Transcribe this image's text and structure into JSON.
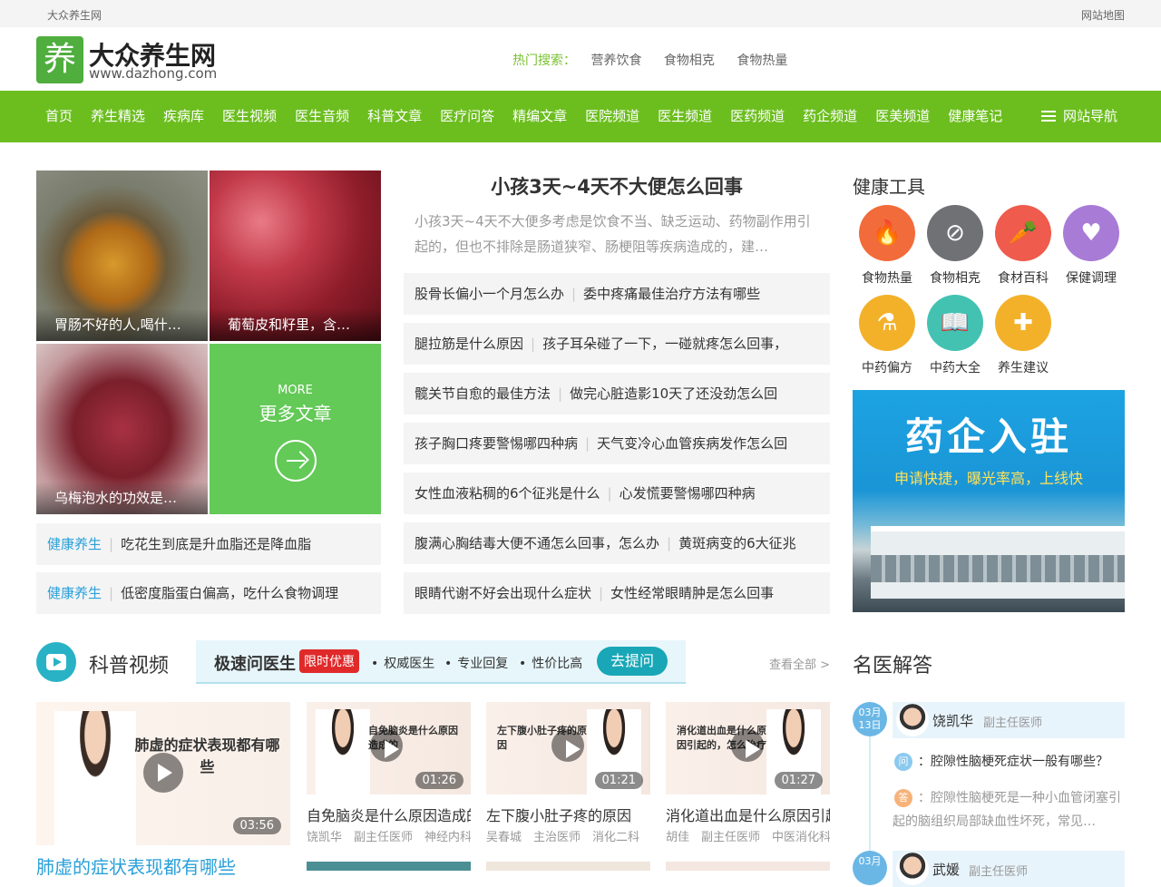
{
  "topbar": {
    "site": "大众养生网",
    "sitemap": "网站地图"
  },
  "header": {
    "logo_char": "养",
    "logo_name": "大众养生网",
    "logo_url": "www.dazhong.com",
    "hot_label": "热门搜索：",
    "hot_keywords": [
      "营养饮食",
      "食物相克",
      "食物热量"
    ]
  },
  "nav": {
    "items": [
      "首页",
      "养生精选",
      "疾病库",
      "医生视频",
      "医生音频",
      "科普文章",
      "医疗问答",
      "精编文章",
      "医院频道",
      "医生频道",
      "医药频道",
      "药企频道",
      "医美频道",
      "健康笔记"
    ],
    "site_nav": "网站导航"
  },
  "featured_tiles": [
    {
      "caption": "胃肠不好的人,喝什…"
    },
    {
      "caption": "葡萄皮和籽里，含…"
    },
    {
      "caption": "乌梅泡水的功效是…"
    }
  ],
  "more": {
    "en": "MORE",
    "cn": "更多文章"
  },
  "left_list": [
    {
      "tag": "健康养生",
      "title": "吃花生到底是升血脂还是降血脂"
    },
    {
      "tag": "健康养生",
      "title": "低密度脂蛋白偏高，吃什么食物调理"
    }
  ],
  "headline": {
    "title": "小孩3天~4天不大便怎么回事",
    "summary": "小孩3天~4天不大便多考虑是饮食不当、缺乏运动、药物副作用引起的，但也不排除是肠道狭窄、肠梗阻等疾病造成的，建…"
  },
  "middle_list": [
    [
      "股骨长偏小一个月怎么办",
      "委中疼痛最佳治疗方法有哪些"
    ],
    [
      "腿拉筋是什么原因",
      "孩子耳朵碰了一下，一碰就疼怎么回事，"
    ],
    [
      "髋关节自愈的最佳方法",
      "做完心脏造影10天了还没劲怎么回"
    ],
    [
      "孩子胸口疼要警惕哪四种病",
      "天气变冷心血管疾病发作怎么回"
    ],
    [
      "女性血液粘稠的6个征兆是什么",
      "心发慌要警惕哪四种病"
    ],
    [
      "腹满心胸结毒大便不通怎么回事，怎么办",
      "黄斑病变的6大征兆"
    ],
    [
      "眼睛代谢不好会出现什么症状",
      "女性经常眼睛肿是怎么回事"
    ]
  ],
  "tools": {
    "title": "健康工具",
    "items": [
      {
        "label": "食物热量",
        "icon": "flame-icon",
        "glyph": "🔥",
        "color": "#f26b3a"
      },
      {
        "label": "食物相克",
        "icon": "forbidden-icon",
        "glyph": "⊘",
        "color": "#6f7175"
      },
      {
        "label": "食材百科",
        "icon": "vegetable-icon",
        "glyph": "🥕",
        "color": "#ef5b4c"
      },
      {
        "label": "保健调理",
        "icon": "heart-hands-icon",
        "glyph": "♥",
        "color": "#a77bd6"
      },
      {
        "label": "中药偏方",
        "icon": "mortar-icon",
        "glyph": "⚗",
        "color": "#f3b12a"
      },
      {
        "label": "中药大全",
        "icon": "book-icon",
        "glyph": "📖",
        "color": "#43c2b2"
      },
      {
        "label": "养生建议",
        "icon": "leaf-plus-icon",
        "glyph": "✚",
        "color": "#f3b12a"
      }
    ]
  },
  "banner": {
    "title": "药企入驻",
    "subtitle": "申请快捷，曝光率高，上线快"
  },
  "video": {
    "section_title": "科普视频",
    "promo_title": "极速问医生",
    "promo_badge": "限时优惠",
    "promo_features": [
      "权威医生",
      "专业回复",
      "性价比高"
    ],
    "ask_button": "去提问",
    "view_all": "查看全部 >",
    "big": {
      "thumb_title": "肺虚的症状表现都有哪些",
      "duration": "03:56",
      "caption": "肺虚的症状表现都有哪些"
    },
    "small": [
      {
        "thumb_title": "自免脑炎是什么原因造成的",
        "duration": "01:26",
        "title": "自免脑炎是什么原因造成的",
        "meta": "饶凯华　副主任医师　神经内科"
      },
      {
        "thumb_title": "左下腹小肚子疼的原因",
        "duration": "01:21",
        "title": "左下腹小肚子疼的原因",
        "meta": "吴春城　主治医师　消化二科"
      },
      {
        "thumb_title": "消化道出血是什么原因引起的，怎么治疗",
        "duration": "01:27",
        "title": "消化道出血是什么原因引起的",
        "meta": "胡佳　副主任医师　中医消化科"
      }
    ]
  },
  "qa": {
    "title": "名医解答",
    "entries": [
      {
        "date": "03月\n13日",
        "doctor": "饶凯华",
        "rank": "副主任医师",
        "q_icon": "问",
        "question": "：腔隙性脑梗死症状一般有哪些？",
        "a_icon": "答",
        "answer": "：腔隙性脑梗死是一种小血管闭塞引起的脑组织局部缺血性坏死，常见…"
      },
      {
        "date": "03月",
        "doctor": "武媛",
        "rank": "副主任医师"
      }
    ]
  }
}
